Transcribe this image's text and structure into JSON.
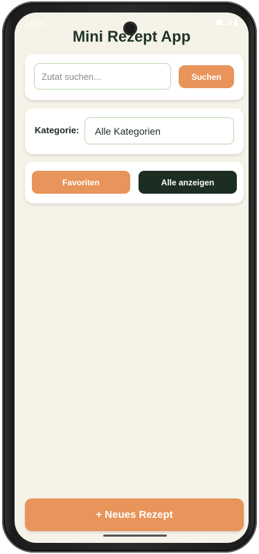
{
  "status_bar": {
    "time": "16:45"
  },
  "app": {
    "title": "Mini Rezept App"
  },
  "search": {
    "placeholder": "Zutat suchen...",
    "value": "",
    "button_label": "Suchen"
  },
  "category": {
    "label": "Kategorie:",
    "selected": "Alle Kategorien"
  },
  "filters": {
    "favorites_label": "Favoriten",
    "show_all_label": "Alle anzeigen"
  },
  "actions": {
    "new_recipe_label": "+ Neues Rezept"
  },
  "colors": {
    "background": "#f5f2e8",
    "accent": "#e8945a",
    "dark": "#1c2e22",
    "input_border": "#b9d8ad",
    "title": "#1f3527"
  },
  "icons": [
    "camera-icon",
    "wifi-icon",
    "signal-icon",
    "battery-icon"
  ]
}
